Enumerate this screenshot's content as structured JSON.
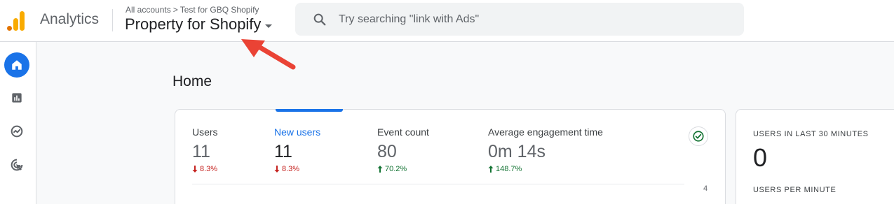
{
  "header": {
    "app_name": "Analytics",
    "breadcrumb": {
      "account": "All accounts",
      "separator": ">",
      "property_path": "Test for GBQ Shopify"
    },
    "property_name": "Property for Shopify",
    "search": {
      "placeholder": "Try searching \"link with Ads\"",
      "value": ""
    }
  },
  "nav": {
    "items": [
      {
        "icon": "home-icon",
        "active": true
      },
      {
        "icon": "reports-icon",
        "active": false
      },
      {
        "icon": "explore-icon",
        "active": false
      },
      {
        "icon": "advertising-icon",
        "active": false
      }
    ]
  },
  "main": {
    "title": "Home",
    "overview": {
      "metrics": [
        {
          "label": "Users",
          "value": "11",
          "delta": "8.3%",
          "direction": "down",
          "active": false
        },
        {
          "label": "New users",
          "value": "11",
          "delta": "8.3%",
          "direction": "down",
          "active": true
        },
        {
          "label": "Event count",
          "value": "80",
          "delta": "70.2%",
          "direction": "up",
          "active": false
        },
        {
          "label": "Average engagement time",
          "value": "0m 14s",
          "delta": "148.7%",
          "direction": "up",
          "active": false
        }
      ],
      "axis_tick": "4"
    },
    "realtime": {
      "label": "USERS IN LAST 30 MINUTES",
      "value": "0",
      "sub_label": "USERS PER MINUTE"
    }
  },
  "colors": {
    "accent": "#1a73e8",
    "down": "#c5221f",
    "up": "#137333",
    "annotation_arrow": "#ea4335",
    "logo_orange": "#e37400",
    "logo_yellow": "#f9ab00"
  }
}
